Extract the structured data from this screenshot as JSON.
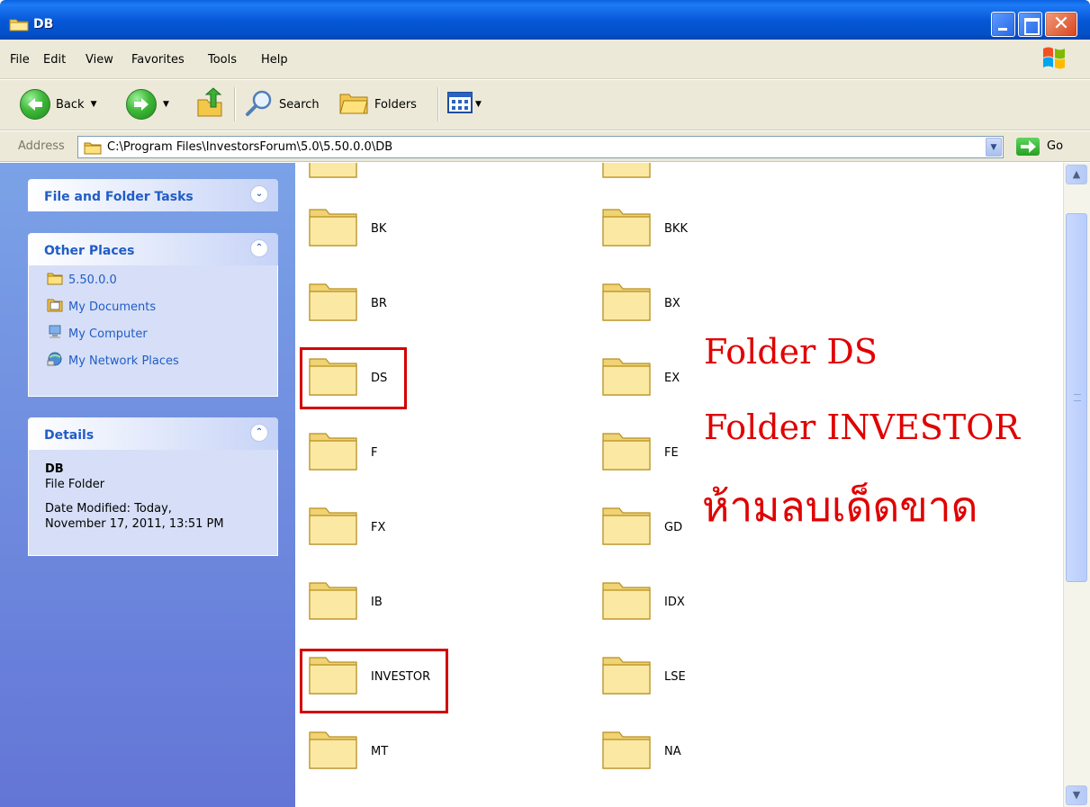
{
  "window": {
    "title": "DB"
  },
  "menu": [
    "File",
    "Edit",
    "View",
    "Favorites",
    "Tools",
    "Help"
  ],
  "toolbar": {
    "back": "Back",
    "search": "Search",
    "folders": "Folders"
  },
  "address": {
    "label": "Address",
    "path": "C:\\Program Files\\InvestorsForum\\5.0\\5.50.0.0\\DB",
    "go": "Go"
  },
  "taskpane": {
    "file_tasks": {
      "title": "File and Folder Tasks"
    },
    "other_places": {
      "title": "Other Places",
      "items": [
        {
          "label": "5.50.0.0",
          "icon": "folder-icon"
        },
        {
          "label": "My Documents",
          "icon": "my-documents-icon"
        },
        {
          "label": "My Computer",
          "icon": "my-computer-icon"
        },
        {
          "label": "My Network Places",
          "icon": "network-places-icon"
        }
      ]
    },
    "details": {
      "title": "Details",
      "name": "DB",
      "type": "File Folder",
      "date_line1": "Date Modified: Today,",
      "date_line2": "November 17, 2011, 13:51 PM"
    }
  },
  "folders": {
    "left": [
      "BK",
      "BR",
      "DS",
      "F",
      "FX",
      "IB",
      "INVESTOR",
      "MT"
    ],
    "right": [
      "BKK",
      "BX",
      "EX",
      "FE",
      "GD",
      "IDX",
      "LSE",
      "NA"
    ]
  },
  "annotation": {
    "line1": "Folder DS",
    "line2": "Folder INVESTOR",
    "line3": "ห้ามลบเด็ดขาด",
    "color": "#e00000"
  }
}
